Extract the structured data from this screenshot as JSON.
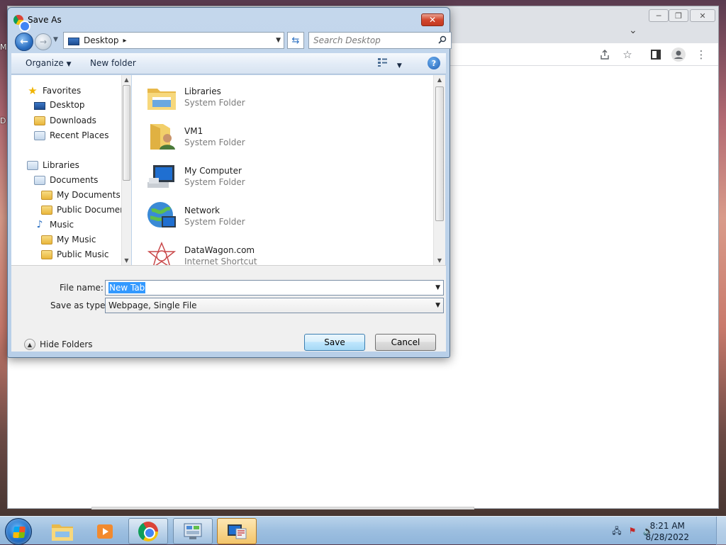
{
  "desktop": {
    "labels": [
      "M",
      "D"
    ]
  },
  "chrome_window": {
    "controls": {
      "minimize": "─",
      "restore": "❐",
      "close": "✕"
    },
    "tab_menu_glyph": "⌄",
    "toolbar_icons": [
      "share-icon",
      "star-icon",
      "side-panel-icon",
      "profile-icon",
      "menu-icon"
    ]
  },
  "dialog": {
    "title": "Save As",
    "close_glyph": "✕",
    "address": {
      "location": "Desktop",
      "separator": "▸"
    },
    "search_placeholder": "Search Desktop",
    "command_bar": {
      "organize": "Organize",
      "new_folder": "New folder",
      "help": "?"
    },
    "nav_pane": {
      "favorites": {
        "label": "Favorites",
        "items": [
          "Desktop",
          "Downloads",
          "Recent Places"
        ]
      },
      "libraries": {
        "label": "Libraries",
        "documents": {
          "label": "Documents",
          "children": [
            "My Documents",
            "Public Documents"
          ]
        },
        "music": {
          "label": "Music",
          "children": [
            "My Music",
            "Public Music"
          ]
        }
      }
    },
    "files": [
      {
        "name": "Libraries",
        "type": "System Folder",
        "icon": "libraries-icon"
      },
      {
        "name": "VM1",
        "type": "System Folder",
        "icon": "user-folder-icon"
      },
      {
        "name": "My Computer",
        "type": "System Folder",
        "icon": "computer-icon"
      },
      {
        "name": "Network",
        "type": "System Folder",
        "icon": "network-icon"
      },
      {
        "name": "DataWagon.com",
        "type": "Internet Shortcut",
        "icon": "internet-shortcut-icon"
      }
    ],
    "file_name_label": "File name:",
    "file_name_value": "New Tab",
    "save_as_type_label": "Save as type:",
    "save_as_type_value": "Webpage, Single File",
    "hide_folders": "Hide Folders",
    "save_button": "Save",
    "cancel_button": "Cancel"
  },
  "taskbar": {
    "apps": [
      "explorer-icon",
      "media-player-icon",
      "chrome-icon",
      "control-panel-icon",
      "remote-desktop-icon"
    ],
    "clock_time": "8:21 AM",
    "clock_date": "8/28/2022"
  }
}
